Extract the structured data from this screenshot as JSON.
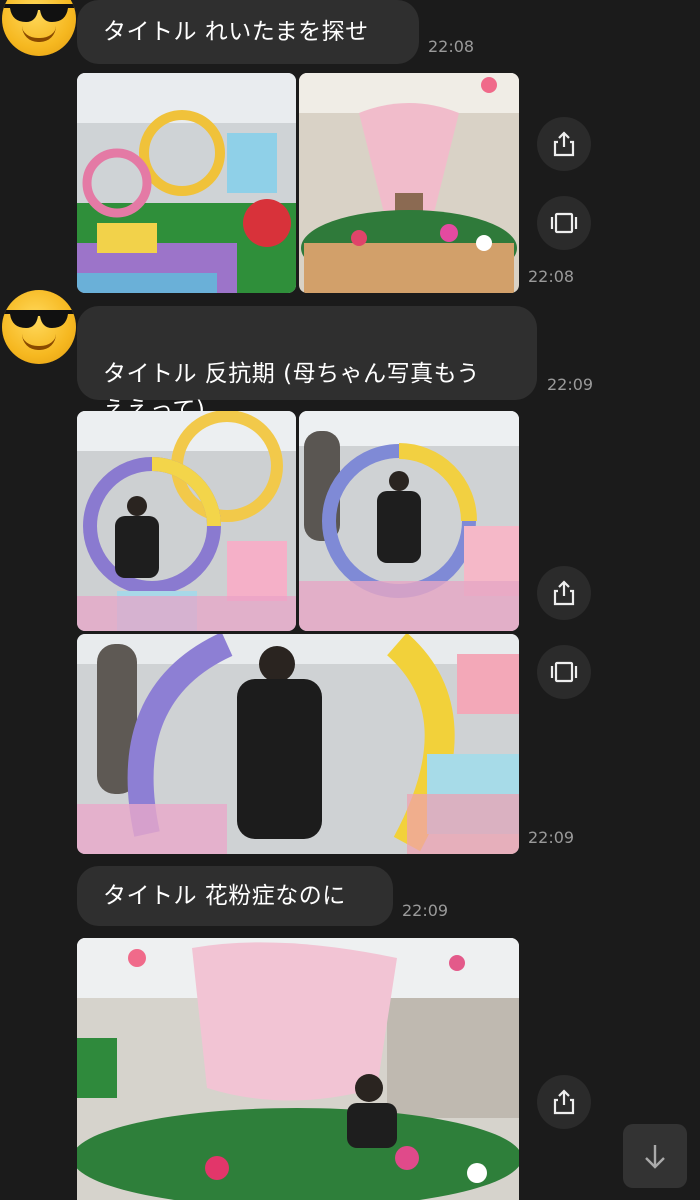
{
  "messages": [
    {
      "text": "タイトル れいたまを探せ",
      "time": "22:08"
    },
    {
      "time": "22:08"
    },
    {
      "text": "タイトル 反抗期 (母ちゃん写真もう\nええって)",
      "time": "22:09"
    },
    {
      "time": "22:09"
    },
    {
      "text": "タイトル 花粉症なのに",
      "time": "22:09"
    }
  ],
  "icons": {
    "share": "share-icon",
    "carousel": "carousel-icon",
    "scroll": "arrow-down-icon",
    "avatar": "sunglasses-emoji-avatar"
  },
  "colors": {
    "background": "#1b1b1b",
    "bubble": "#2f2f2f",
    "timestamp": "#9a9a9a"
  }
}
